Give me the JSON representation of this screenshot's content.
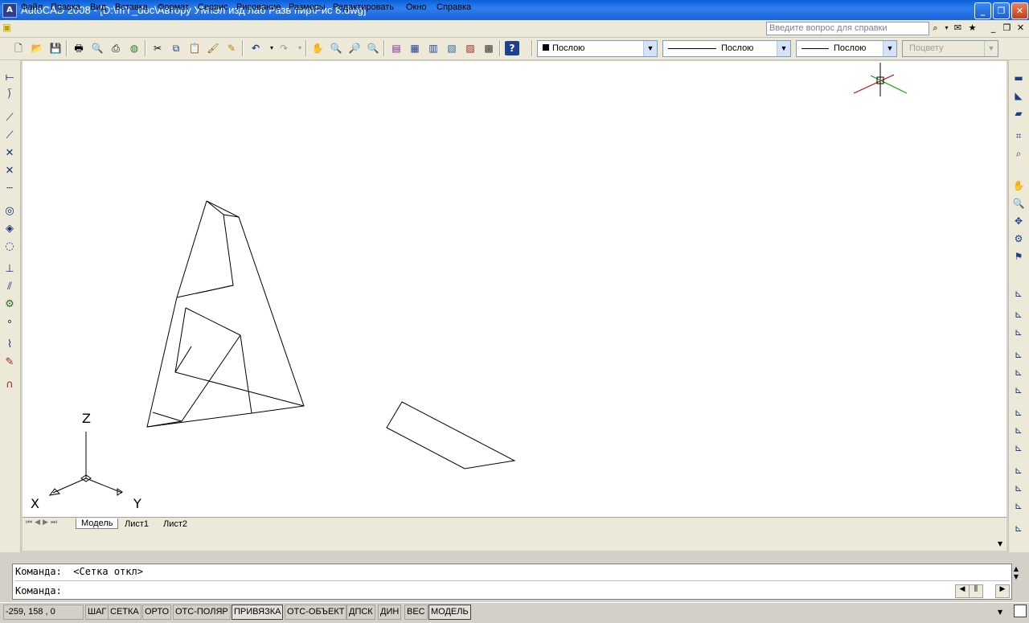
{
  "window": {
    "title": "AutoCAD 2008 - [D:\\mY_doc\\Автору УМ\\Эл изд лаб Разв пир\\Рис 8.dwg]",
    "app_icon": "autocad-icon"
  },
  "menu": {
    "items": [
      "Файл",
      "Правка",
      "Вид",
      "Вставка",
      "Формат",
      "Сервис",
      "Рисование",
      "Размеры",
      "Редактировать",
      "Окно",
      "Справка"
    ],
    "help_placeholder": "Введите вопрос для справки"
  },
  "properties": {
    "color": "Послою",
    "linetype": "Послою",
    "lineweight": "Послою",
    "plotstyle": "Поцвету"
  },
  "ucs": {
    "z": "Z",
    "x": "X",
    "y": "Y"
  },
  "tabs": [
    "Модель",
    "Лист1",
    "Лист2"
  ],
  "command": {
    "history": "Команда:  <Сетка откл>",
    "prompt": "Команда:"
  },
  "status": {
    "coords": "-259, 158 , 0",
    "toggles": [
      "ШАГ",
      "СЕТКА",
      "ОРТО",
      "ОТС-ПОЛЯР",
      "ПРИВЯЗКА",
      "ОТС-ОБЪЕКТ",
      "ДПСК",
      "ДИН",
      "ВЕС"
    ],
    "active_toggle": "ПРИВЯЗКА",
    "space": "МОДЕЛЬ"
  },
  "colors": {
    "title_bar": "#0a5fd8",
    "canvas": "#ffffff",
    "chrome": "#ece9d8"
  }
}
